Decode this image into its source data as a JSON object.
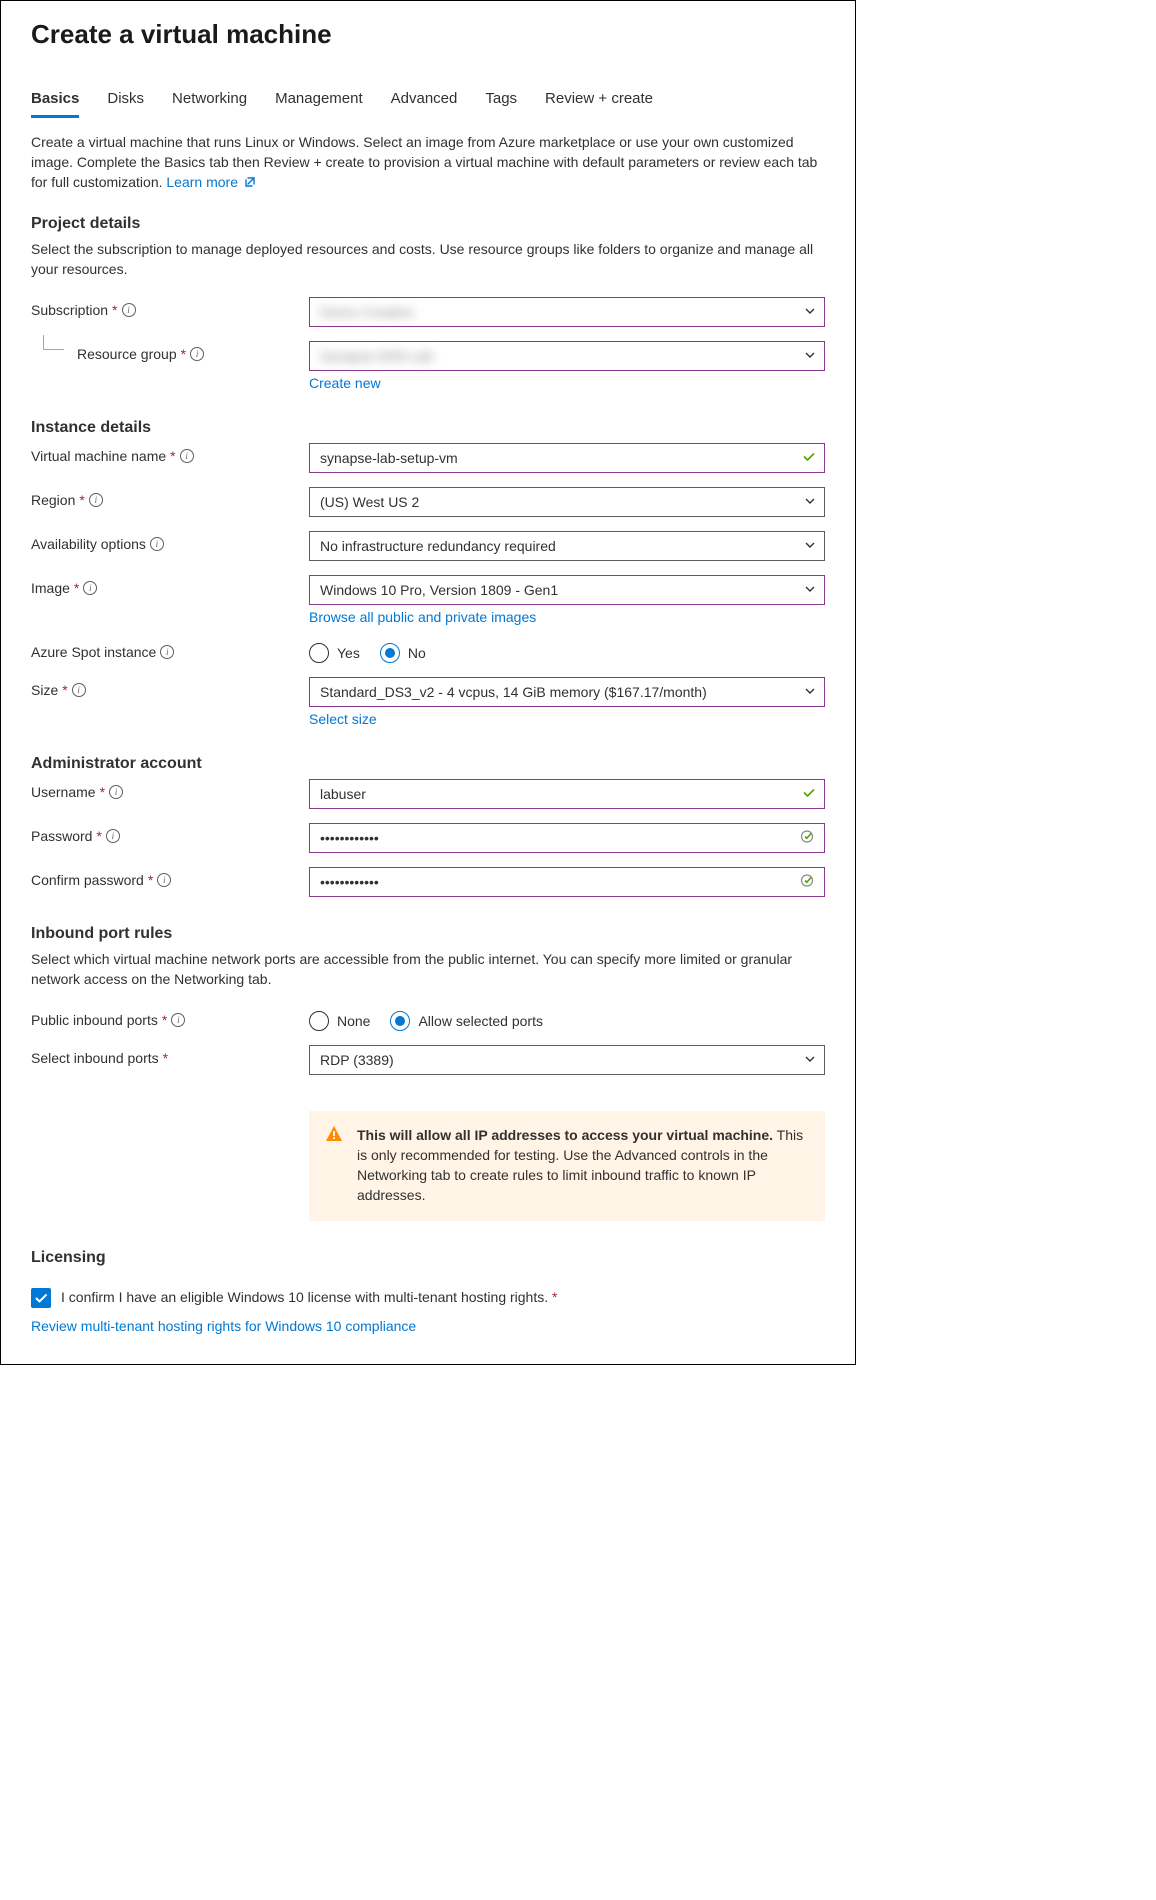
{
  "page_title": "Create a virtual machine",
  "tabs": [
    "Basics",
    "Disks",
    "Networking",
    "Management",
    "Advanced",
    "Tags",
    "Review + create"
  ],
  "active_tab_index": 0,
  "intro": "Create a virtual machine that runs Linux or Windows. Select an image from Azure marketplace or use your own customized image. Complete the Basics tab then Review + create to provision a virtual machine with default parameters or review each tab for full customization.",
  "learn_more": "Learn more",
  "sections": {
    "project": {
      "title": "Project details",
      "desc": "Select the subscription to manage deployed resources and costs. Use resource groups like folders to organize and manage all your resources.",
      "subscription_label": "Subscription",
      "subscription_value": "Demo Creation",
      "resource_group_label": "Resource group",
      "resource_group_value": "Synapse-WW-Lab",
      "create_new": "Create new"
    },
    "instance": {
      "title": "Instance details",
      "vm_name_label": "Virtual machine name",
      "vm_name_value": "synapse-lab-setup-vm",
      "region_label": "Region",
      "region_value": "(US) West US 2",
      "availability_label": "Availability options",
      "availability_value": "No infrastructure redundancy required",
      "image_label": "Image",
      "image_value": "Windows 10 Pro, Version 1809 - Gen1",
      "browse_images": "Browse all public and private images",
      "spot_label": "Azure Spot instance",
      "spot_yes": "Yes",
      "spot_no": "No",
      "size_label": "Size",
      "size_value": "Standard_DS3_v2 - 4 vcpus, 14 GiB memory ($167.17/month)",
      "select_size": "Select size"
    },
    "admin": {
      "title": "Administrator account",
      "username_label": "Username",
      "username_value": "labuser",
      "password_label": "Password",
      "password_value": "••••••••••••",
      "confirm_label": "Confirm password",
      "confirm_value": "••••••••••••"
    },
    "inbound": {
      "title": "Inbound port rules",
      "desc": "Select which virtual machine network ports are accessible from the public internet. You can specify more limited or granular network access on the Networking tab.",
      "public_ports_label": "Public inbound ports",
      "none": "None",
      "allow": "Allow selected ports",
      "select_ports_label": "Select inbound ports",
      "select_ports_value": "RDP (3389)",
      "warning_bold": "This will allow all IP addresses to access your virtual machine.",
      "warning_rest": " This is only recommended for testing.  Use the Advanced controls in the Networking tab to create rules to limit inbound traffic to known IP addresses."
    },
    "licensing": {
      "title": "Licensing",
      "confirm_text": "I confirm I have an eligible Windows 10 license with multi-tenant hosting rights.",
      "review_link": "Review multi-tenant hosting rights for Windows 10 compliance"
    }
  }
}
